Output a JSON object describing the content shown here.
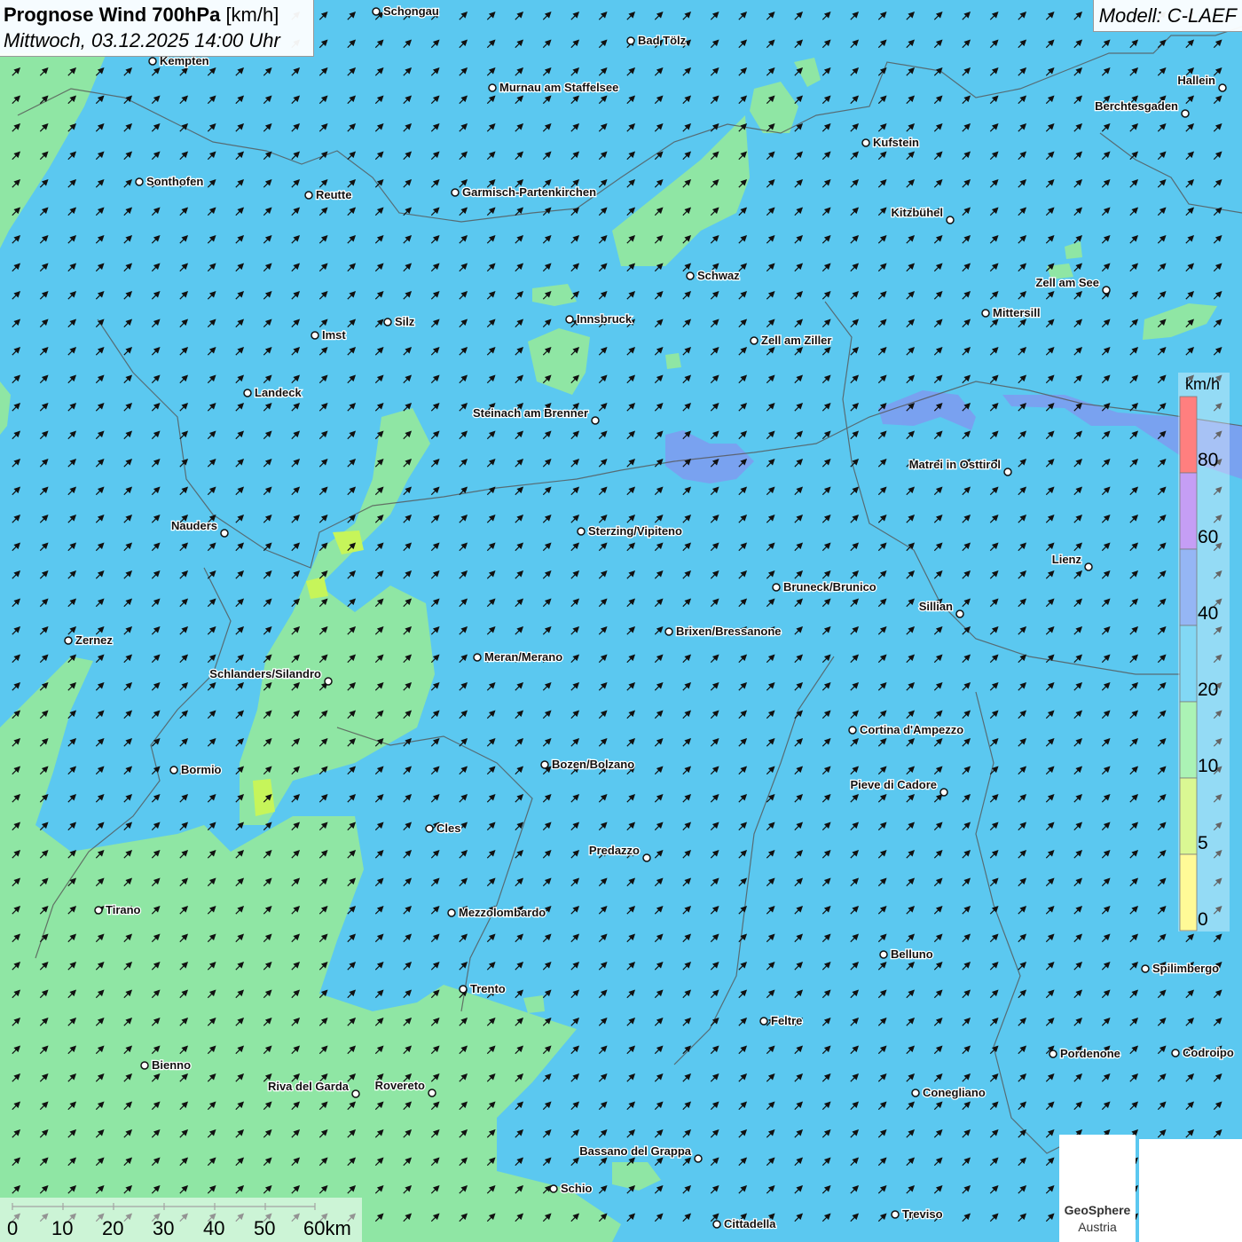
{
  "title": {
    "main_bold": "Prognose Wind 700hPa",
    "unit": "[km/h]",
    "datetime": "Mittwoch, 03.12.2025 14:00 Uhr"
  },
  "model": "Modell: C-LAEF",
  "legend": {
    "unit": "km/h",
    "ticks": [
      "80",
      "60",
      "40",
      "20",
      "10",
      "5",
      "0"
    ],
    "colors": [
      "#ff3b3b",
      "#a76bf0",
      "#5c8ff0",
      "#40c4f0",
      "#7eed8e",
      "#c6f55a",
      "#fff760"
    ]
  },
  "scalebar": {
    "labels": [
      "0",
      "10",
      "20",
      "30",
      "40",
      "50",
      "60km"
    ]
  },
  "logos": {
    "geosphere_name": "GeoSphere",
    "geosphere_sub": "Austria"
  },
  "colors": {
    "wind_20_40": "#5bc8f0",
    "wind_10_20": "#8fe6a4",
    "wind_5_10": "#c6f55a",
    "wind_40_60": "#7f9bf0",
    "arrow": "#111111",
    "border": "#555555"
  },
  "arrow_direction_deg": 45,
  "cities": [
    {
      "name": "Schongau"
    },
    {
      "name": "Bad Tölz"
    },
    {
      "name": "Kempten"
    },
    {
      "name": "Murnau am Staffelsee"
    },
    {
      "name": "Hallein"
    },
    {
      "name": "Berchtesgaden"
    },
    {
      "name": "Kufstein"
    },
    {
      "name": "Sonthofen"
    },
    {
      "name": "Reutte"
    },
    {
      "name": "Garmisch-Partenkirchen"
    },
    {
      "name": "Kitzbühel"
    },
    {
      "name": "Schwaz"
    },
    {
      "name": "Zell am See"
    },
    {
      "name": "Innsbruck"
    },
    {
      "name": "Mittersill"
    },
    {
      "name": "Silz"
    },
    {
      "name": "Imst"
    },
    {
      "name": "Zell am Ziller"
    },
    {
      "name": "Landeck"
    },
    {
      "name": "Steinach am Brenner"
    },
    {
      "name": "Matrei in Osttirol"
    },
    {
      "name": "Nauders"
    },
    {
      "name": "Sterzing/Vipiteno"
    },
    {
      "name": "Lienz"
    },
    {
      "name": "Bruneck/Brunico"
    },
    {
      "name": "Sillian"
    },
    {
      "name": "Zernez"
    },
    {
      "name": "Brixen/Bressanone"
    },
    {
      "name": "Meran/Merano"
    },
    {
      "name": "Schlanders/Silandro"
    },
    {
      "name": "Cortina d'Ampezzo"
    },
    {
      "name": "Bormio"
    },
    {
      "name": "Bozen/Bolzano"
    },
    {
      "name": "Pieve di Cadore"
    },
    {
      "name": "Cles"
    },
    {
      "name": "Predazzo"
    },
    {
      "name": "Tirano"
    },
    {
      "name": "Mezzolombardo"
    },
    {
      "name": "Belluno"
    },
    {
      "name": "Spilimbergo"
    },
    {
      "name": "Trento"
    },
    {
      "name": "Feltre"
    },
    {
      "name": "Pordenone"
    },
    {
      "name": "Codroipo"
    },
    {
      "name": "Bienno"
    },
    {
      "name": "Riva del Garda"
    },
    {
      "name": "Rovereto"
    },
    {
      "name": "Conegliano"
    },
    {
      "name": "Bassano del Grappa"
    },
    {
      "name": "Schio"
    },
    {
      "name": "Treviso"
    },
    {
      "name": "Cittadella"
    }
  ]
}
